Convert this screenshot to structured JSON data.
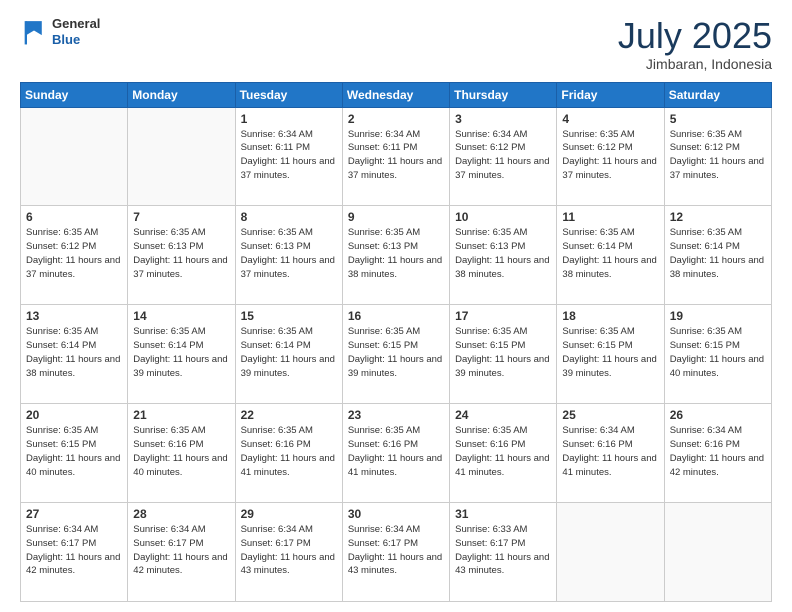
{
  "header": {
    "logo_general": "General",
    "logo_blue": "Blue",
    "month": "July 2025",
    "location": "Jimbaran, Indonesia"
  },
  "weekdays": [
    "Sunday",
    "Monday",
    "Tuesday",
    "Wednesday",
    "Thursday",
    "Friday",
    "Saturday"
  ],
  "weeks": [
    [
      {
        "day": "",
        "info": ""
      },
      {
        "day": "",
        "info": ""
      },
      {
        "day": "1",
        "info": "Sunrise: 6:34 AM\nSunset: 6:11 PM\nDaylight: 11 hours and 37 minutes."
      },
      {
        "day": "2",
        "info": "Sunrise: 6:34 AM\nSunset: 6:11 PM\nDaylight: 11 hours and 37 minutes."
      },
      {
        "day": "3",
        "info": "Sunrise: 6:34 AM\nSunset: 6:12 PM\nDaylight: 11 hours and 37 minutes."
      },
      {
        "day": "4",
        "info": "Sunrise: 6:35 AM\nSunset: 6:12 PM\nDaylight: 11 hours and 37 minutes."
      },
      {
        "day": "5",
        "info": "Sunrise: 6:35 AM\nSunset: 6:12 PM\nDaylight: 11 hours and 37 minutes."
      }
    ],
    [
      {
        "day": "6",
        "info": "Sunrise: 6:35 AM\nSunset: 6:12 PM\nDaylight: 11 hours and 37 minutes."
      },
      {
        "day": "7",
        "info": "Sunrise: 6:35 AM\nSunset: 6:13 PM\nDaylight: 11 hours and 37 minutes."
      },
      {
        "day": "8",
        "info": "Sunrise: 6:35 AM\nSunset: 6:13 PM\nDaylight: 11 hours and 37 minutes."
      },
      {
        "day": "9",
        "info": "Sunrise: 6:35 AM\nSunset: 6:13 PM\nDaylight: 11 hours and 38 minutes."
      },
      {
        "day": "10",
        "info": "Sunrise: 6:35 AM\nSunset: 6:13 PM\nDaylight: 11 hours and 38 minutes."
      },
      {
        "day": "11",
        "info": "Sunrise: 6:35 AM\nSunset: 6:14 PM\nDaylight: 11 hours and 38 minutes."
      },
      {
        "day": "12",
        "info": "Sunrise: 6:35 AM\nSunset: 6:14 PM\nDaylight: 11 hours and 38 minutes."
      }
    ],
    [
      {
        "day": "13",
        "info": "Sunrise: 6:35 AM\nSunset: 6:14 PM\nDaylight: 11 hours and 38 minutes."
      },
      {
        "day": "14",
        "info": "Sunrise: 6:35 AM\nSunset: 6:14 PM\nDaylight: 11 hours and 39 minutes."
      },
      {
        "day": "15",
        "info": "Sunrise: 6:35 AM\nSunset: 6:14 PM\nDaylight: 11 hours and 39 minutes."
      },
      {
        "day": "16",
        "info": "Sunrise: 6:35 AM\nSunset: 6:15 PM\nDaylight: 11 hours and 39 minutes."
      },
      {
        "day": "17",
        "info": "Sunrise: 6:35 AM\nSunset: 6:15 PM\nDaylight: 11 hours and 39 minutes."
      },
      {
        "day": "18",
        "info": "Sunrise: 6:35 AM\nSunset: 6:15 PM\nDaylight: 11 hours and 39 minutes."
      },
      {
        "day": "19",
        "info": "Sunrise: 6:35 AM\nSunset: 6:15 PM\nDaylight: 11 hours and 40 minutes."
      }
    ],
    [
      {
        "day": "20",
        "info": "Sunrise: 6:35 AM\nSunset: 6:15 PM\nDaylight: 11 hours and 40 minutes."
      },
      {
        "day": "21",
        "info": "Sunrise: 6:35 AM\nSunset: 6:16 PM\nDaylight: 11 hours and 40 minutes."
      },
      {
        "day": "22",
        "info": "Sunrise: 6:35 AM\nSunset: 6:16 PM\nDaylight: 11 hours and 41 minutes."
      },
      {
        "day": "23",
        "info": "Sunrise: 6:35 AM\nSunset: 6:16 PM\nDaylight: 11 hours and 41 minutes."
      },
      {
        "day": "24",
        "info": "Sunrise: 6:35 AM\nSunset: 6:16 PM\nDaylight: 11 hours and 41 minutes."
      },
      {
        "day": "25",
        "info": "Sunrise: 6:34 AM\nSunset: 6:16 PM\nDaylight: 11 hours and 41 minutes."
      },
      {
        "day": "26",
        "info": "Sunrise: 6:34 AM\nSunset: 6:16 PM\nDaylight: 11 hours and 42 minutes."
      }
    ],
    [
      {
        "day": "27",
        "info": "Sunrise: 6:34 AM\nSunset: 6:17 PM\nDaylight: 11 hours and 42 minutes."
      },
      {
        "day": "28",
        "info": "Sunrise: 6:34 AM\nSunset: 6:17 PM\nDaylight: 11 hours and 42 minutes."
      },
      {
        "day": "29",
        "info": "Sunrise: 6:34 AM\nSunset: 6:17 PM\nDaylight: 11 hours and 43 minutes."
      },
      {
        "day": "30",
        "info": "Sunrise: 6:34 AM\nSunset: 6:17 PM\nDaylight: 11 hours and 43 minutes."
      },
      {
        "day": "31",
        "info": "Sunrise: 6:33 AM\nSunset: 6:17 PM\nDaylight: 11 hours and 43 minutes."
      },
      {
        "day": "",
        "info": ""
      },
      {
        "day": "",
        "info": ""
      }
    ]
  ]
}
